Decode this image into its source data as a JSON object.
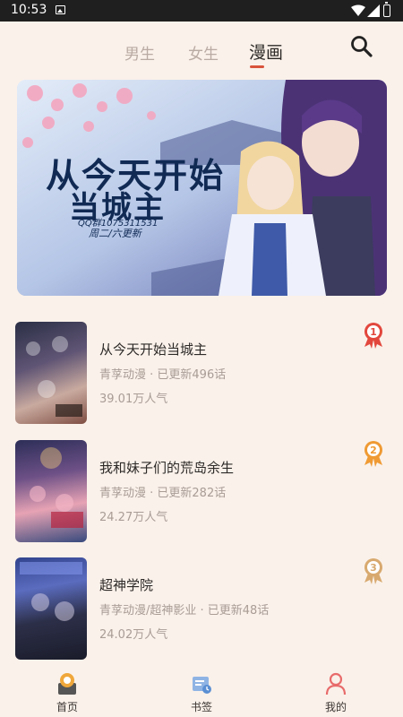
{
  "status_bar": {
    "time": "10:53"
  },
  "tabs": [
    {
      "label": "男生",
      "active": false
    },
    {
      "label": "女生",
      "active": false
    },
    {
      "label": "漫画",
      "active": true
    }
  ],
  "banner": {
    "title_line1": "从今天开始",
    "title_line2": "当城主",
    "qq": "QQ群1075311531",
    "update": "周二/六更新"
  },
  "comics": [
    {
      "rank": "1",
      "title": "从今天开始当城主",
      "meta": "青莩动漫 · 已更新496话",
      "popularity": "39.01万人气"
    },
    {
      "rank": "2",
      "title": "我和妹子们的荒岛余生",
      "meta": "青莩动漫 · 已更新282话",
      "popularity": "24.27万人气"
    },
    {
      "rank": "3",
      "title": "超神学院",
      "meta": "青莩动漫/超神影业 · 已更新48话",
      "popularity": "24.02万人气"
    }
  ],
  "bottom_nav": [
    {
      "label": "首页",
      "icon": "home-icon"
    },
    {
      "label": "书签",
      "icon": "bookmark-icon"
    },
    {
      "label": "我的",
      "icon": "profile-icon"
    }
  ],
  "colors": {
    "background": "#faf1ea",
    "accent": "#d9533b",
    "rank1": "#e2473d",
    "rank2": "#ef9a33",
    "rank3": "#d8a96e"
  }
}
